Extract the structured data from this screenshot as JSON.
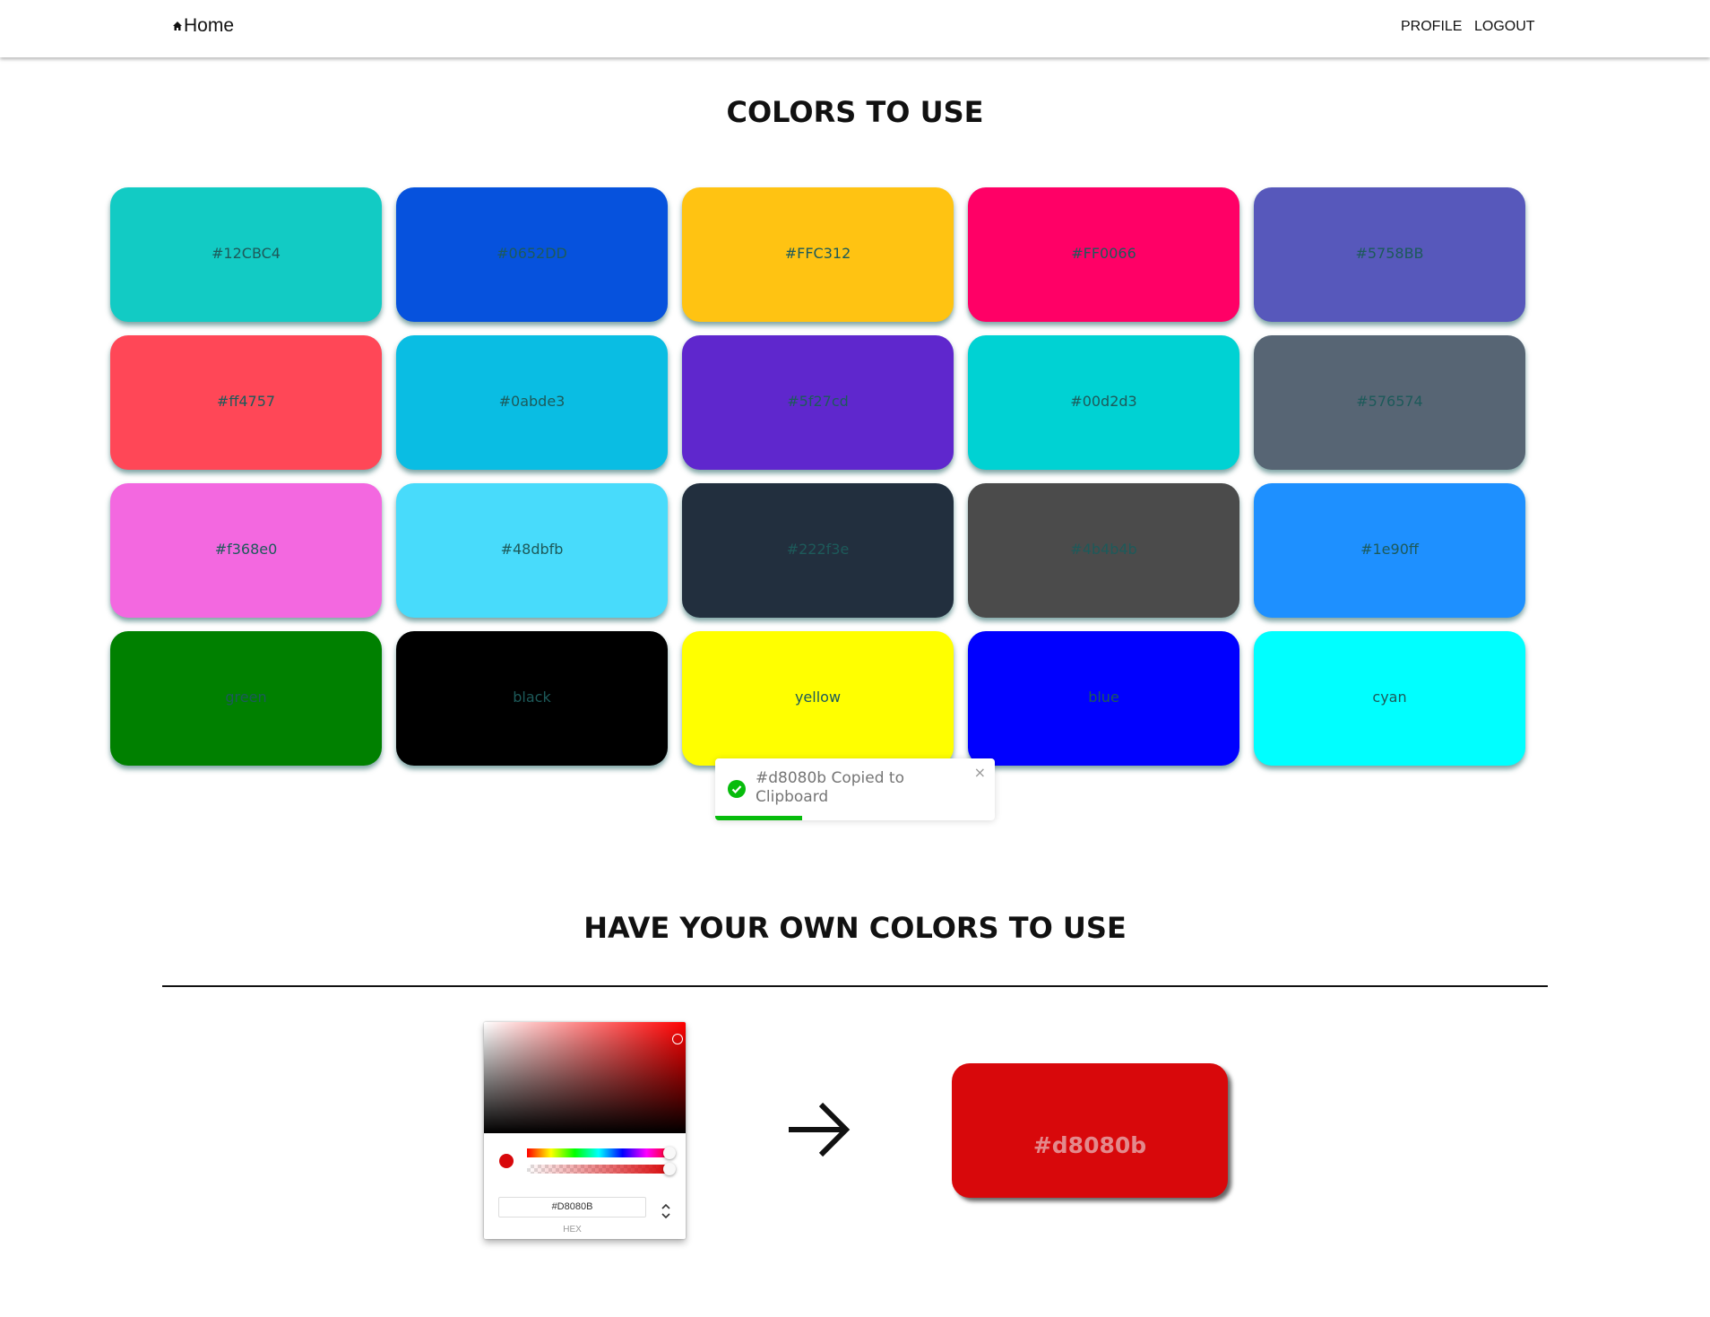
{
  "nav": {
    "home_label": "Home",
    "profile_label": "PROFILE",
    "logout_label": "LOGOUT"
  },
  "main": {
    "title": "COLORS TO USE",
    "colors": [
      {
        "label": "#12CBC4",
        "hex": "#12CBC4"
      },
      {
        "label": "#0652DD",
        "hex": "#0652DD"
      },
      {
        "label": "#FFC312",
        "hex": "#FFC312"
      },
      {
        "label": "#FF0066",
        "hex": "#FF0066"
      },
      {
        "label": "#5758BB",
        "hex": "#5758BB"
      },
      {
        "label": "#ff4757",
        "hex": "#ff4757"
      },
      {
        "label": "#0abde3",
        "hex": "#0abde3"
      },
      {
        "label": "#5f27cd",
        "hex": "#5f27cd"
      },
      {
        "label": "#00d2d3",
        "hex": "#00d2d3"
      },
      {
        "label": "#576574",
        "hex": "#576574"
      },
      {
        "label": "#f368e0",
        "hex": "#f368e0"
      },
      {
        "label": "#48dbfb",
        "hex": "#48dbfb"
      },
      {
        "label": "#222f3e",
        "hex": "#222f3e"
      },
      {
        "label": "#4b4b4b",
        "hex": "#4b4b4b"
      },
      {
        "label": "#1e90ff",
        "hex": "#1e90ff"
      },
      {
        "label": "green",
        "hex": "green"
      },
      {
        "label": "black",
        "hex": "black"
      },
      {
        "label": "yellow",
        "hex": "yellow"
      },
      {
        "label": "blue",
        "hex": "blue"
      },
      {
        "label": "cyan",
        "hex": "cyan"
      }
    ]
  },
  "toast": {
    "message": "#d8080b Copied to Clipboard",
    "close": "×",
    "icon": "check-circle-icon",
    "progress_percent": 31,
    "color": "#07bc0c"
  },
  "custom": {
    "title": "HAVE YOUR OWN COLORS TO USE",
    "picker": {
      "hex_value": "#D8080B",
      "format_label": "HEX",
      "toggle": "⌃⌄"
    },
    "preview_label": "#d8080b",
    "preview_color": "#d8080b"
  }
}
